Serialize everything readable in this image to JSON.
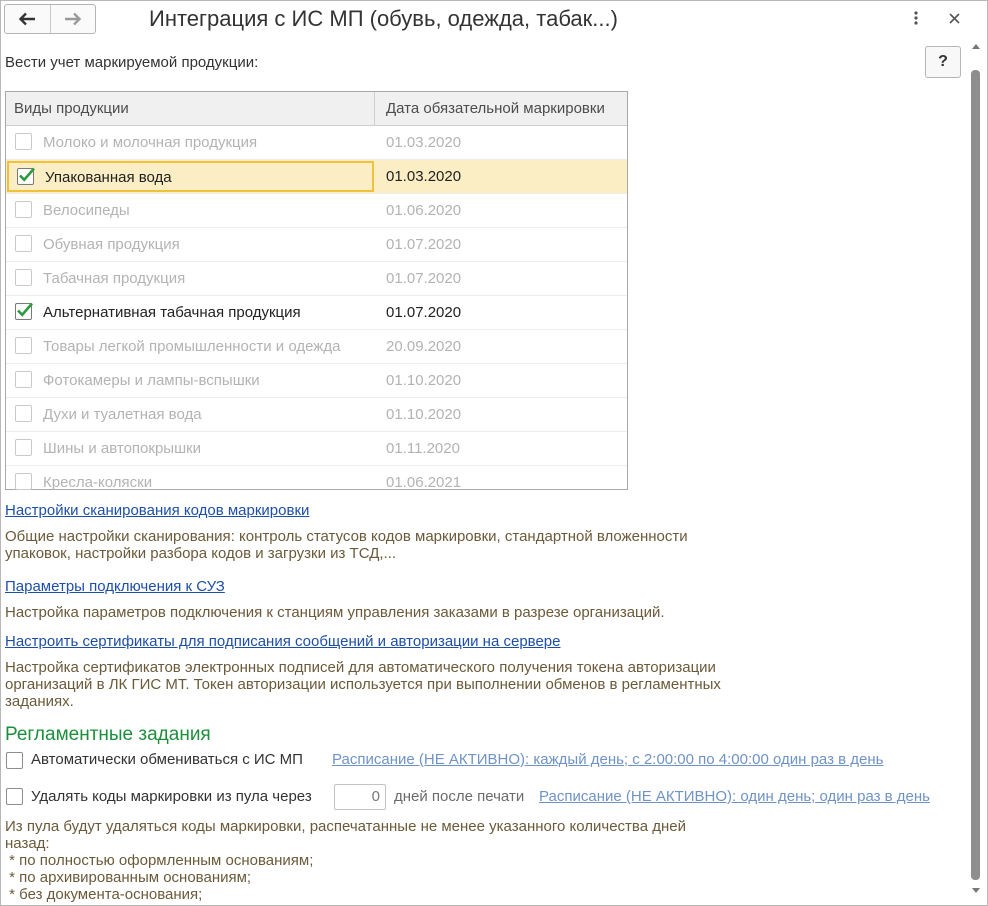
{
  "window": {
    "title": "Интеграция с ИС МП (обувь, одежда, табак...)",
    "help_label": "?"
  },
  "section_label": "Вести учет маркируемой продукции:",
  "table": {
    "columns": [
      "Виды продукции",
      "Дата обязательной маркировки"
    ],
    "rows": [
      {
        "name": "Молоко и молочная продукция",
        "date": "01.03.2020",
        "checked": false
      },
      {
        "name": "Упакованная вода",
        "date": "01.03.2020",
        "checked": true
      },
      {
        "name": "Велосипеды",
        "date": "01.06.2020",
        "checked": false
      },
      {
        "name": "Обувная продукция",
        "date": "01.07.2020",
        "checked": false
      },
      {
        "name": "Табачная продукция",
        "date": "01.07.2020",
        "checked": false
      },
      {
        "name": "Альтернативная табачная продукция",
        "date": "01.07.2020",
        "checked": true
      },
      {
        "name": "Товары легкой промышленности и одежда",
        "date": "20.09.2020",
        "checked": false
      },
      {
        "name": "Фотокамеры и лампы-вспышки",
        "date": "01.10.2020",
        "checked": false
      },
      {
        "name": "Духи и туалетная вода",
        "date": "01.10.2020",
        "checked": false
      },
      {
        "name": "Шины и автопокрышки",
        "date": "01.11.2020",
        "checked": false
      },
      {
        "name": "Кресла-коляски",
        "date": "01.06.2021",
        "checked": false
      }
    ]
  },
  "links": {
    "scan_settings": "Настройки сканирования кодов маркировки",
    "scan_desc_1": "Общие настройки сканирования: контроль статусов кодов маркировки, стандартной вложенности",
    "scan_desc_2": "упаковок, настройки разбора кодов и загрузки из ТСД,...",
    "suz_params": "Параметры подключения к СУЗ",
    "suz_desc": "Настройка параметров подключения к станциям управления заказами в разрезе организаций.",
    "certs": "Настроить сертификаты для подписания сообщений и авторизации на сервере",
    "certs_desc_1": "Настройка сертификатов электронных подписей для автоматического получения токена авторизации",
    "certs_desc_2": "организаций в ЛК ГИС МТ. Токен авторизации используется при выполнении обменов в регламентных",
    "certs_desc_3": "заданиях."
  },
  "scheduled": {
    "heading": "Регламентные задания",
    "auto_exchange_label": "Автоматически обмениваться с ИС МП",
    "auto_exchange_schedule": "Расписание (НЕ АКТИВНО): каждый день; с 2:00:00 по 4:00:00 один раз в день",
    "delete_codes_label": "Удалять коды маркировки из пула через",
    "delete_days_value": "0",
    "delete_days_suffix": "дней после печати",
    "delete_schedule": "Расписание (НЕ АКТИВНО): один день; один раз в день",
    "note_1": "Из пула будут удаляться коды маркировки, распечатанные не менее указанного количества дней",
    "note_2": "назад:",
    "note_3": " * по полностью оформленным основаниям;",
    "note_4": " * по архивированным основаниям;",
    "note_5": " * без документа-основания;"
  },
  "icons": {
    "back": "arrow-left-icon",
    "forward": "arrow-right-icon",
    "more": "more-vertical-icon",
    "close": "close-icon",
    "check": "checkmark-icon"
  },
  "colors": {
    "link": "#1d4fa8",
    "heading_green": "#1d8f3c",
    "selection": "#fbeec4",
    "selection_border": "#f2c13c",
    "check_green": "#2e9a3f"
  }
}
